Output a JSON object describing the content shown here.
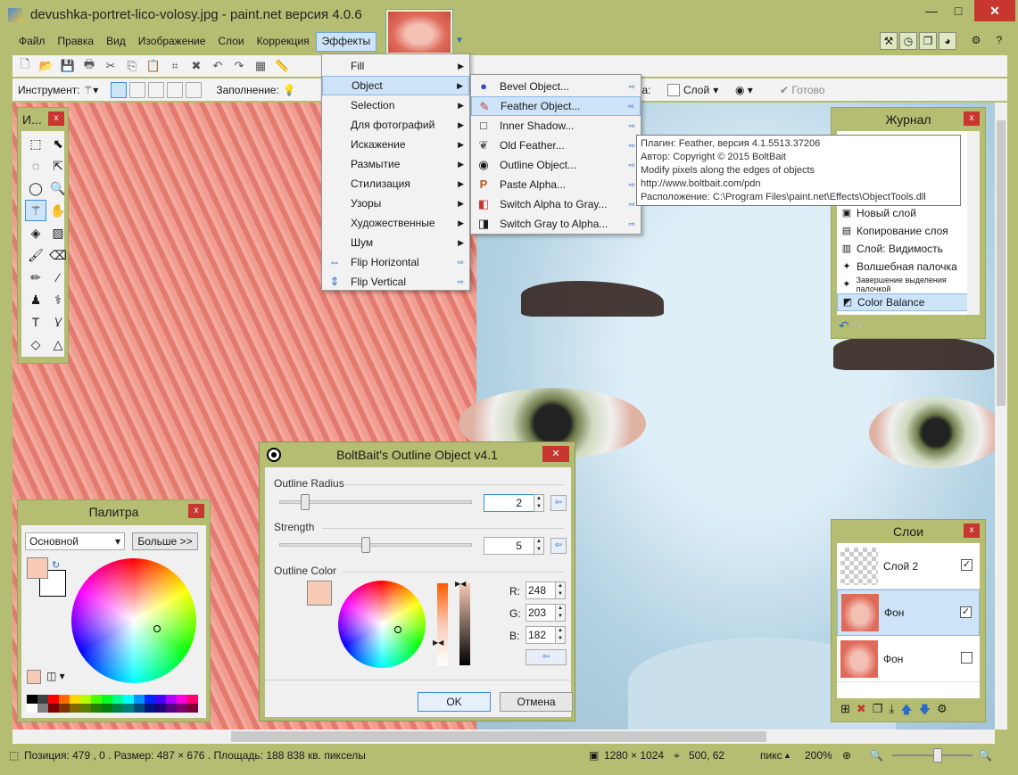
{
  "window": {
    "title": "devushka-portret-lico-volosy.jpg - paint.net версия 4.0.6",
    "minimize": "—",
    "maximize": "□",
    "close": "✕"
  },
  "menu": [
    "Файл",
    "Правка",
    "Вид",
    "Изображение",
    "Слои",
    "Коррекция",
    "Эффекты"
  ],
  "toolbar2": {
    "instrument_label": "Инструмент:",
    "fill_label": "Заполнение:",
    "bpart": "ка:",
    "layer_label": "Слой",
    "done_label": "Готово"
  },
  "effects_menu": [
    {
      "label": "Fill",
      "icon": ""
    },
    {
      "label": "Object",
      "icon": ""
    },
    {
      "label": "Selection",
      "icon": ""
    },
    {
      "label": "Для фотографий",
      "icon": ""
    },
    {
      "label": "Искажение",
      "icon": ""
    },
    {
      "label": "Размытие",
      "icon": ""
    },
    {
      "label": "Стилизация",
      "icon": ""
    },
    {
      "label": "Узоры",
      "icon": ""
    },
    {
      "label": "Художественные",
      "icon": ""
    },
    {
      "label": "Шум",
      "icon": ""
    },
    {
      "label": "Flip Horizontal",
      "icon": "⇔"
    },
    {
      "label": "Flip Vertical",
      "icon": "⇕"
    }
  ],
  "object_submenu": [
    {
      "label": "Bevel Object...",
      "icon": "●"
    },
    {
      "label": "Feather Object...",
      "icon": "✎"
    },
    {
      "label": "Inner Shadow...",
      "icon": "□"
    },
    {
      "label": "Old Feather...",
      "icon": "❦"
    },
    {
      "label": "Outline Object...",
      "icon": "◉"
    },
    {
      "label": "Paste Alpha...",
      "icon": "P"
    },
    {
      "label": "Switch Alpha to Gray...",
      "icon": "◧"
    },
    {
      "label": "Switch Gray to Alpha...",
      "icon": "◨"
    }
  ],
  "tooltip": [
    "Плагин: Feather, версия 4.1.5513.37206",
    "Автор: Copyright © 2015 BoltBait",
    "Modify pixels along the edges of objects",
    "http://www.boltbait.com/pdn",
    "Расположение: C:\\Program Files\\paint.net\\Effects\\ObjectTools.dll"
  ],
  "tools_panel": {
    "title": "И...",
    "close": "x"
  },
  "history_panel": {
    "title": "Журнал",
    "close": "x",
    "items": [
      {
        "label": "Новый слой",
        "icon": "▣"
      },
      {
        "label": "Копирование слоя",
        "icon": "▤"
      },
      {
        "label": "Слой: Видимость",
        "icon": "▥"
      },
      {
        "label": "Волшебная палочка",
        "icon": "✦"
      },
      {
        "label": "Завершение выделения палочкой",
        "icon": "✦"
      },
      {
        "label": "Color Balance",
        "icon": "◩"
      }
    ]
  },
  "layers_panel": {
    "title": "Слои",
    "close": "x",
    "layers": [
      {
        "name": "Слой 2",
        "checked": "✓"
      },
      {
        "name": "Фон",
        "checked": "✓"
      },
      {
        "name": "Фон",
        "checked": ""
      }
    ]
  },
  "palette_panel": {
    "title": "Палитра",
    "close": "x",
    "mode": "Основной",
    "more": "Больше >>",
    "colors": [
      "#000000",
      "#404040",
      "#ff0000",
      "#ff6a00",
      "#ffd800",
      "#b6ff00",
      "#4cff00",
      "#00ff21",
      "#00ff90",
      "#00ffff",
      "#0094ff",
      "#0026ff",
      "#4800ff",
      "#b200ff",
      "#ff00dc",
      "#ff006e",
      "#ffffff",
      "#808080",
      "#7f0000",
      "#7f3300",
      "#7f6a00",
      "#5b7f00",
      "#267f00",
      "#007f0e",
      "#007f46",
      "#007f7f",
      "#004a7f",
      "#00137f",
      "#21007f",
      "#57007f",
      "#7f006e",
      "#7f0037"
    ]
  },
  "dialog": {
    "title": "BoltBait's Outline Object v4.1",
    "close": "✕",
    "radius_label": "Outline Radius",
    "radius_value": "2",
    "strength_label": "Strength",
    "strength_value": "5",
    "color_label": "Outline Color",
    "r_label": "R:",
    "r_value": "248",
    "g_label": "G:",
    "g_value": "203",
    "b_label": "B:",
    "b_value": "182",
    "ok": "OK",
    "cancel": "Отмена",
    "swatch_color": "#f8cbb6"
  },
  "status": {
    "text": "Позиция: 479 , 0 . Размер: 487  × 676 . Площадь: 188 838 кв. пикселы",
    "image_size": "1280 × 1024",
    "cursor": "500, 62",
    "unit": "пикс",
    "zoom": "200%"
  },
  "colors": {
    "accent": "#b4bd72",
    "close": "#c7372f",
    "highlight": "#cde3f8"
  }
}
